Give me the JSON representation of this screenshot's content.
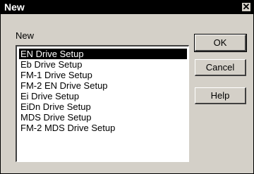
{
  "window": {
    "title": "New",
    "close_glyph": "✕"
  },
  "list": {
    "label": "New",
    "items": [
      "EN Drive Setup",
      "Eb Drive Setup",
      "FM-1 Drive Setup",
      "FM-2 EN Drive Setup",
      "Ei Drive Setup",
      "EiDn Drive Setup",
      "MDS Drive Setup",
      "FM-2 MDS Drive Setup"
    ],
    "selected_index": 0
  },
  "buttons": {
    "ok_label": "OK",
    "cancel_label": "Cancel",
    "help_label": "Help"
  }
}
